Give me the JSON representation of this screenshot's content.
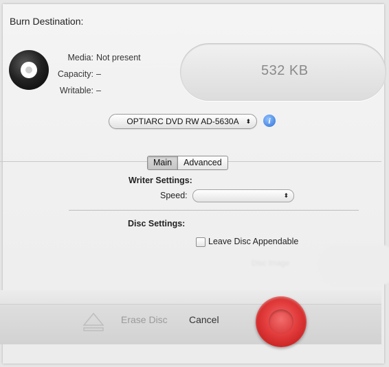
{
  "header": {
    "title": "Burn Destination:"
  },
  "media_info": {
    "media_label": "Media:",
    "media_value": "Not present",
    "capacity_label": "Capacity:",
    "capacity_value": "–",
    "writable_label": "Writable:",
    "writable_value": "–"
  },
  "size_display": "532 KB",
  "drive": {
    "selected": "OPTIARC DVD RW AD-5630A"
  },
  "tabs": [
    {
      "label": "Main",
      "selected": true
    },
    {
      "label": "Advanced",
      "selected": false
    }
  ],
  "writer_settings": {
    "heading": "Writer Settings:",
    "speed_label": "Speed:",
    "speed_value": ""
  },
  "disc_settings": {
    "heading": "Disc Settings:",
    "appendable_label": "Leave Disc Appendable",
    "appendable_checked": false
  },
  "ghost_text": {
    "disc_image": "Disc Image"
  },
  "footer": {
    "erase_label": "Erase Disc",
    "cancel_label": "Cancel"
  },
  "colors": {
    "burn_button": "#e23b3b",
    "info_button": "#2f6fd6",
    "disabled_text": "#9a9a9a"
  }
}
